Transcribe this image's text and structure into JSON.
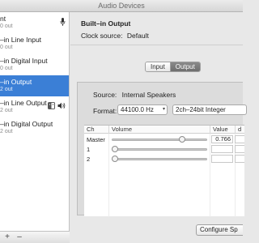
{
  "window": {
    "title": "Audio Devices"
  },
  "sidebar": {
    "items": [
      {
        "name": "nt",
        "io": "0 out",
        "selected": false,
        "icons": [
          "microphone-icon"
        ]
      },
      {
        "name": "–in Line Input",
        "io": "0 out",
        "selected": false,
        "icons": []
      },
      {
        "name": "–in Digital Input",
        "io": "0 out",
        "selected": false,
        "icons": []
      },
      {
        "name": "–in Output",
        "io": "2 out",
        "selected": true,
        "icons": []
      },
      {
        "name": "–in Line Output",
        "io": "2 out",
        "selected": false,
        "icons": [
          "finder-icon",
          "speaker-icon"
        ]
      },
      {
        "name": "–in Digital Output",
        "io": "2 out",
        "selected": false,
        "icons": []
      }
    ],
    "bottom": {
      "add": "+",
      "remove": "–"
    }
  },
  "main": {
    "device_title": "Built–in Output",
    "clock": {
      "label": "Clock source:",
      "value": "Default"
    },
    "tabs": [
      {
        "label": "Input",
        "active": false
      },
      {
        "label": "Output",
        "active": true
      }
    ],
    "source": {
      "label": "Source:",
      "value": "Internal Speakers"
    },
    "format": {
      "label": "Format:",
      "rate": "44100.0 Hz",
      "bits": "2ch–24bit Integer"
    },
    "table": {
      "headers": {
        "ch": "Ch",
        "volume": "Volume",
        "value": "Value",
        "db": "d"
      },
      "rows": [
        {
          "ch": "Master",
          "value": "0.766",
          "level": 0.766
        },
        {
          "ch": "1",
          "value": "",
          "level": 0
        },
        {
          "ch": "2",
          "value": "",
          "level": 0
        }
      ]
    },
    "configure_button": "Configure Sp"
  },
  "colors": {
    "selection": "#3b7fd6",
    "tab_active": "#7a7a7a"
  }
}
